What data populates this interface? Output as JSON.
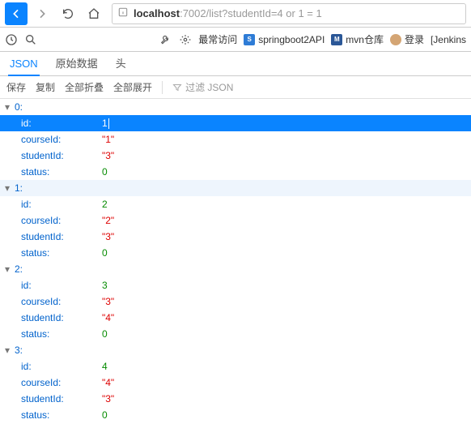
{
  "nav": {
    "url_host": "localhost",
    "url_port": ":7002",
    "url_path": "/list?studentId=4 or 1 = 1"
  },
  "toolbar": {
    "freq_visit": "最常访问",
    "bm1": "springboot2API",
    "bm2": "mvn仓库",
    "login": "登录",
    "jenkins": "[Jenkins"
  },
  "tabs": {
    "json": "JSON",
    "raw": "原始数据",
    "headers": "头"
  },
  "actions": {
    "save": "保存",
    "copy": "复制",
    "collapse": "全部折叠",
    "expand": "全部展开",
    "filter": "过滤 JSON"
  },
  "items": [
    {
      "idx": "0:",
      "id": "1",
      "courseId": "\"1\"",
      "studentId": "\"3\"",
      "status": "0"
    },
    {
      "idx": "1:",
      "id": "2",
      "courseId": "\"2\"",
      "studentId": "\"3\"",
      "status": "0"
    },
    {
      "idx": "2:",
      "id": "3",
      "courseId": "\"3\"",
      "studentId": "\"4\"",
      "status": "0"
    },
    {
      "idx": "3:",
      "id": "4",
      "courseId": "\"4\"",
      "studentId": "\"3\"",
      "status": "0"
    }
  ],
  "keys": {
    "id": "id:",
    "courseId": "courseId:",
    "studentId": "studentId:",
    "status": "status:"
  }
}
